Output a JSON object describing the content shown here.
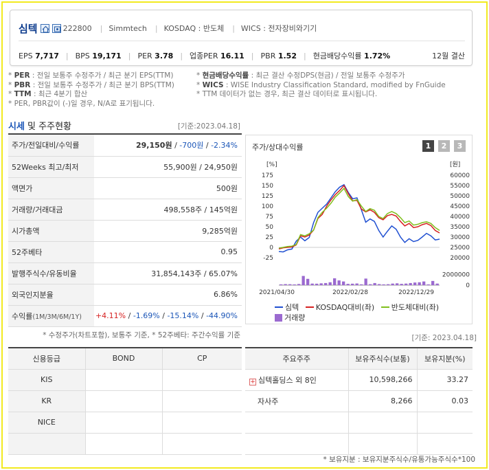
{
  "header": {
    "name": "심텍",
    "code": "222800",
    "eng_name": "Simmtech",
    "market": "KOSDAQ : 반도체",
    "wics": "WICS : 전자장비와기기",
    "stats": [
      {
        "label": "EPS",
        "value": "7,717"
      },
      {
        "label": "BPS",
        "value": "19,171"
      },
      {
        "label": "PER",
        "value": "3.78"
      },
      {
        "label": "업종PER",
        "value": "16.11"
      },
      {
        "label": "PBR",
        "value": "1.52"
      },
      {
        "label": "현금배당수익률",
        "value": "1.72%"
      }
    ],
    "settlement": "12월 결산"
  },
  "notes": {
    "left": [
      {
        "key": "PER",
        "text": ": 전일 보통주 수정주가 / 최근 분기 EPS(TTM)"
      },
      {
        "key": "PBR",
        "text": ": 전일 보통주 수정주가 / 최근 분기 BPS(TTM)"
      },
      {
        "key": "TTM",
        "text": ": 최근 4분기 합산"
      },
      {
        "key": "",
        "text": "PER, PBR값이 (-)일 경우, N/A로 표기됩니다."
      }
    ],
    "right": [
      {
        "key": "현금배당수익률",
        "text": ": 최근 결산 수정DPS(현금) / 전일 보통주 수정주가"
      },
      {
        "key": "WICS",
        "text": ": WISE Industry Classification Standard, modified by FnGuide"
      },
      {
        "key": "",
        "text": "TTM 데이터가 없는 경우, 최근 결산 데이터로 표시됩니다."
      }
    ]
  },
  "section": {
    "title_hl": "시세",
    "title_rest": " 및 주주현황",
    "date": "[기준:2023.04.18]"
  },
  "price_table": {
    "price_label": "주가/전일대비/수익률",
    "price": "29,150원",
    "change": "-700원",
    "rate": "-2.34%",
    "rows": [
      {
        "label": "52Weeks 최고/최저",
        "value": "55,900원 / 24,950원"
      },
      {
        "label": "액면가",
        "value": "500원"
      },
      {
        "label": "거래량/거래대금",
        "value": "498,558주 / 145억원"
      },
      {
        "label": "시가총액",
        "value": "9,285억원"
      },
      {
        "label": "52주베타",
        "value": "0.95"
      },
      {
        "label": "발행주식수/유동비율",
        "value": "31,854,143주 / 65.07%"
      },
      {
        "label": "외국인지분율",
        "value": "6.86%"
      }
    ],
    "return_label": "수익률",
    "return_period": "(1M/3M/6M/1Y)",
    "returns": [
      "+4.11%",
      "-1.69%",
      "-15.14%",
      "-44.90%"
    ]
  },
  "price_footnote": "* 수정주가(차트포함), 보통주 기준, * 52주베타: 주간수익률 기준",
  "shareholder_date": "[기준: 2023.04.18]",
  "chart_panel": {
    "title": "주가/상대수익률",
    "pages": [
      "1",
      "2",
      "3"
    ]
  },
  "chart_data": {
    "type": "line",
    "left_axis_unit": "[%]",
    "right_axis_unit": "[원]",
    "left_ticks": [
      "175",
      "150",
      "125",
      "100",
      "75",
      "50",
      "25",
      "0",
      "-25"
    ],
    "right_ticks": [
      "60000",
      "55000",
      "50000",
      "45000",
      "40000",
      "35000",
      "30000",
      "25000",
      "20000"
    ],
    "volume_ticks": [
      "2000000",
      "0"
    ],
    "x_labels": [
      "2021/04/30",
      "2022/02/28",
      "2022/12/29"
    ],
    "ylim_left": [
      -25,
      175
    ],
    "volume_max": 3000000,
    "series": [
      {
        "name": "심텍",
        "color": "#1f4fd1",
        "values": [
          -10,
          -11,
          -6,
          -4,
          15,
          25,
          16,
          24,
          60,
          85,
          95,
          105,
          120,
          135,
          146,
          152,
          133,
          118,
          120,
          91,
          61,
          69,
          63,
          41,
          25,
          39,
          52,
          44,
          25,
          12,
          21,
          14,
          17,
          25,
          34,
          28,
          18,
          20
        ]
      },
      {
        "name": "KOSDAQ대비(좌)",
        "color": "#d62020",
        "values": [
          -4,
          -1,
          0,
          1,
          6,
          28,
          25,
          30,
          42,
          70,
          80,
          100,
          115,
          128,
          138,
          150,
          130,
          113,
          114,
          93,
          86,
          91,
          85,
          72,
          67,
          77,
          80,
          76,
          63,
          52,
          58,
          48,
          50,
          55,
          58,
          53,
          41,
          35
        ]
      },
      {
        "name": "반도체대비(좌)",
        "color": "#7fbf1c",
        "values": [
          -2,
          0,
          2,
          3,
          7,
          31,
          28,
          33,
          42,
          72,
          85,
          95,
          107,
          122,
          132,
          143,
          123,
          112,
          116,
          100,
          87,
          94,
          90,
          75,
          70,
          82,
          87,
          82,
          72,
          60,
          64,
          54,
          56,
          60,
          62,
          58,
          48,
          41
        ]
      }
    ],
    "volume": {
      "name": "거래량",
      "color": "#9b6ad0",
      "values": [
        150000,
        200000,
        180000,
        140000,
        220000,
        1750000,
        1200000,
        300000,
        280000,
        350000,
        400000,
        550000,
        1300000,
        900000,
        700000,
        250000,
        280000,
        320000,
        160000,
        1250000,
        180000,
        400000,
        200000,
        150000,
        180000,
        300000,
        350000,
        250000,
        300000,
        400000,
        500000,
        550000,
        700000,
        150000,
        800000,
        300000
      ]
    }
  },
  "credit_table": {
    "headers": [
      "신용등급",
      "BOND",
      "CP"
    ],
    "rows": [
      {
        "agency": "KIS",
        "bond": "",
        "cp": ""
      },
      {
        "agency": "KR",
        "bond": "",
        "cp": ""
      },
      {
        "agency": "NICE",
        "bond": "",
        "cp": ""
      },
      {
        "agency": "",
        "bond": "",
        "cp": ""
      }
    ]
  },
  "shareholder_table": {
    "headers": [
      "주요주주",
      "보유주식수(보통)",
      "보유지분(%)"
    ],
    "rows": [
      {
        "name": "심텍홀딩스 외 8인",
        "shares": "10,598,266",
        "pct": "33.27",
        "expand": true,
        "expand_icon": "plus-icon"
      },
      {
        "name": "자사주",
        "shares": "8,266",
        "pct": "0.03",
        "expand": false
      },
      {
        "name": "",
        "shares": "",
        "pct": "",
        "expand": false
      },
      {
        "name": "",
        "shares": "",
        "pct": "",
        "expand": false
      }
    ]
  },
  "bottom_note": "* 보유지분 : 보유지분주식수/유통가능주식수*100"
}
